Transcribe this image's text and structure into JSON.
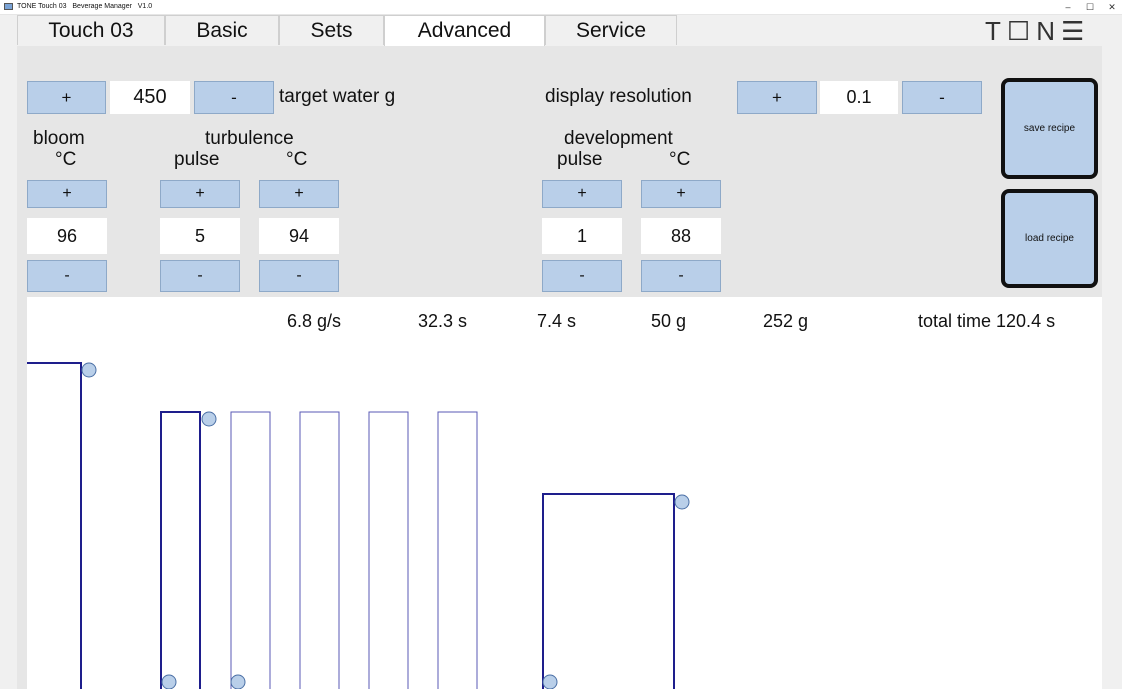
{
  "window": {
    "title": "TONE Touch 03   Beverage Manager   V1.0",
    "minimize": "–",
    "maximize": "☐",
    "close": "✕"
  },
  "tabs": [
    {
      "label": "Touch 03",
      "active": false
    },
    {
      "label": "Basic",
      "active": false
    },
    {
      "label": "Sets",
      "active": false
    },
    {
      "label": "Advanced",
      "active": true
    },
    {
      "label": "Service",
      "active": false
    }
  ],
  "logo": "T☐N☰",
  "controls": {
    "plus": "+",
    "minus": "-",
    "target_water": {
      "value": "450",
      "label": "target water g"
    },
    "display_resolution": {
      "label": "display resolution",
      "value": "0.1"
    },
    "bloom": {
      "heading": "bloom",
      "unit": "°C",
      "value": "96"
    },
    "turbulence": {
      "heading": "turbulence",
      "pulse_label": "pulse",
      "unit": "°C",
      "pulse_value": "5",
      "temp_value": "94"
    },
    "development": {
      "heading": "development",
      "pulse_label": "pulse",
      "unit": "°C",
      "pulse_value": "1",
      "temp_value": "88"
    },
    "save_recipe": "save recipe",
    "load_recipe": "load recipe"
  },
  "stats": {
    "flow": "6.8 g/s",
    "time1": "32.3 s",
    "time2": "7.4 s",
    "weight1": "50 g",
    "weight2": "252 g",
    "total_time": "total time 120.4 s"
  },
  "colors": {
    "accent": "#b9cfe9",
    "plot_line": "#1e1e8c",
    "handle": "#b9cfe9"
  }
}
